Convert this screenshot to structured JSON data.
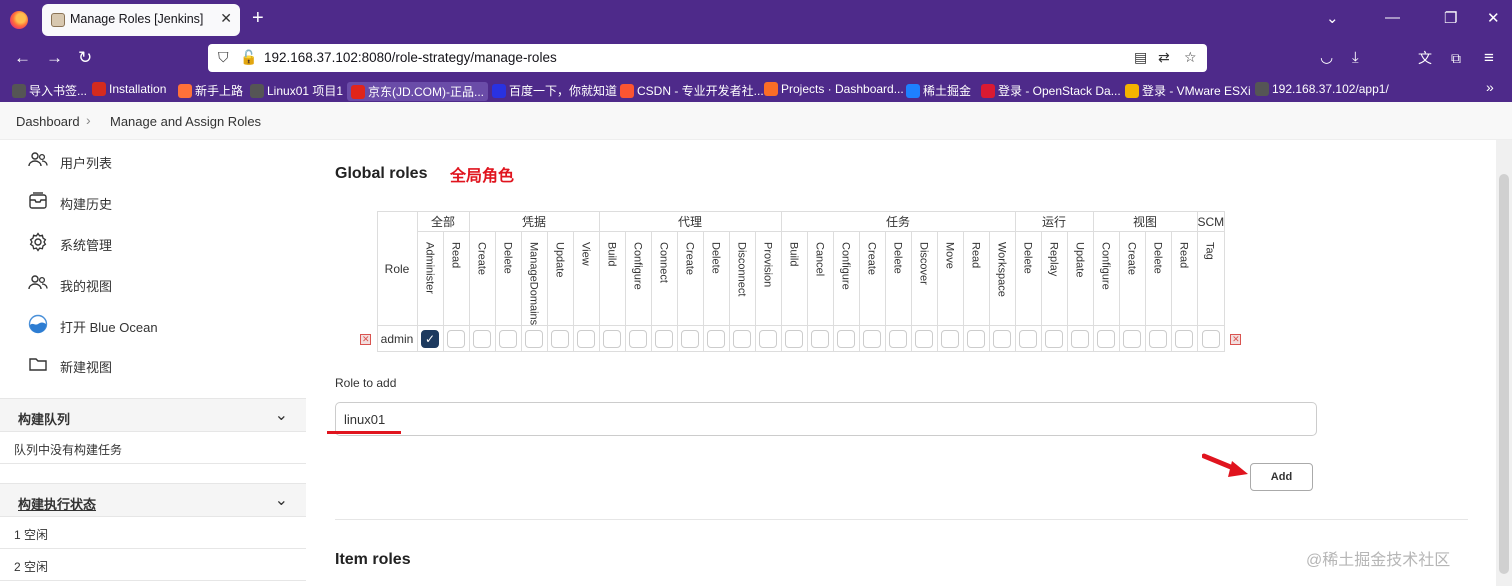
{
  "browser": {
    "tab_title": "Manage Roles [Jenkins]",
    "url": "192.168.37.102:8080/role-strategy/manage-roles",
    "bookmarks": [
      {
        "label": "导入书签...",
        "color": "#555555"
      },
      {
        "label": "Installation",
        "color": "#d52b1e"
      },
      {
        "label": "新手上路",
        "color": "#ff7139"
      },
      {
        "label": "Linux01 项目1",
        "color": "#555555"
      },
      {
        "label": "京东(JD.COM)-正品...",
        "color": "#e1251b"
      },
      {
        "label": "百度一下，你就知道",
        "color": "#2932e1"
      },
      {
        "label": "CSDN - 专业开发者社...",
        "color": "#fc5531"
      },
      {
        "label": "Projects · Dashboard...",
        "color": "#fc6d26"
      },
      {
        "label": "稀土掘金",
        "color": "#1e80ff"
      },
      {
        "label": "登录 - OpenStack Da...",
        "color": "#da1a32"
      },
      {
        "label": "登录 - VMware ESXi",
        "color": "#f4b400"
      },
      {
        "label": "192.168.37.102/app1/",
        "color": "#555555"
      }
    ]
  },
  "breadcrumb": {
    "home": "Dashboard",
    "current": "Manage and Assign Roles"
  },
  "sidebar": {
    "items": [
      {
        "label": "用户列表",
        "icon": "users-icon"
      },
      {
        "label": "构建历史",
        "icon": "history-icon"
      },
      {
        "label": "系统管理",
        "icon": "gear-icon"
      },
      {
        "label": "我的视图",
        "icon": "users-icon"
      },
      {
        "label": "打开 Blue Ocean",
        "icon": "blue-ocean-icon"
      },
      {
        "label": "新建视图",
        "icon": "folder-icon"
      }
    ],
    "queue": {
      "title": "构建队列",
      "empty": "队列中没有构建任务"
    },
    "executors": {
      "title": "构建执行状态",
      "rows": [
        "1  空闲",
        "2  空闲"
      ]
    }
  },
  "main": {
    "global_title": "Global roles",
    "annotation": "全局角色",
    "role_header": "Role",
    "groups": [
      {
        "label": "全部",
        "perms": [
          "Administer",
          "Read"
        ]
      },
      {
        "label": "凭据",
        "perms": [
          "Create",
          "Delete",
          "ManageDomains",
          "Update",
          "View"
        ]
      },
      {
        "label": "代理",
        "perms": [
          "Build",
          "Configure",
          "Connect",
          "Create",
          "Delete",
          "Disconnect",
          "Provision"
        ]
      },
      {
        "label": "任务",
        "perms": [
          "Build",
          "Cancel",
          "Configure",
          "Create",
          "Delete",
          "Discover",
          "Move",
          "Read",
          "Workspace"
        ]
      },
      {
        "label": "运行",
        "perms": [
          "Delete",
          "Replay",
          "Update"
        ]
      },
      {
        "label": "视图",
        "perms": [
          "Configure",
          "Create",
          "Delete",
          "Read"
        ]
      },
      {
        "label": "SCM",
        "perms": [
          "Tag"
        ]
      }
    ],
    "roles": [
      {
        "name": "admin",
        "checked": [
          0
        ]
      }
    ],
    "role_to_add_label": "Role to add",
    "role_to_add_value": "linux01",
    "add_label": "Add",
    "item_title": "Item roles"
  },
  "watermark": "@稀土掘金技术社区"
}
